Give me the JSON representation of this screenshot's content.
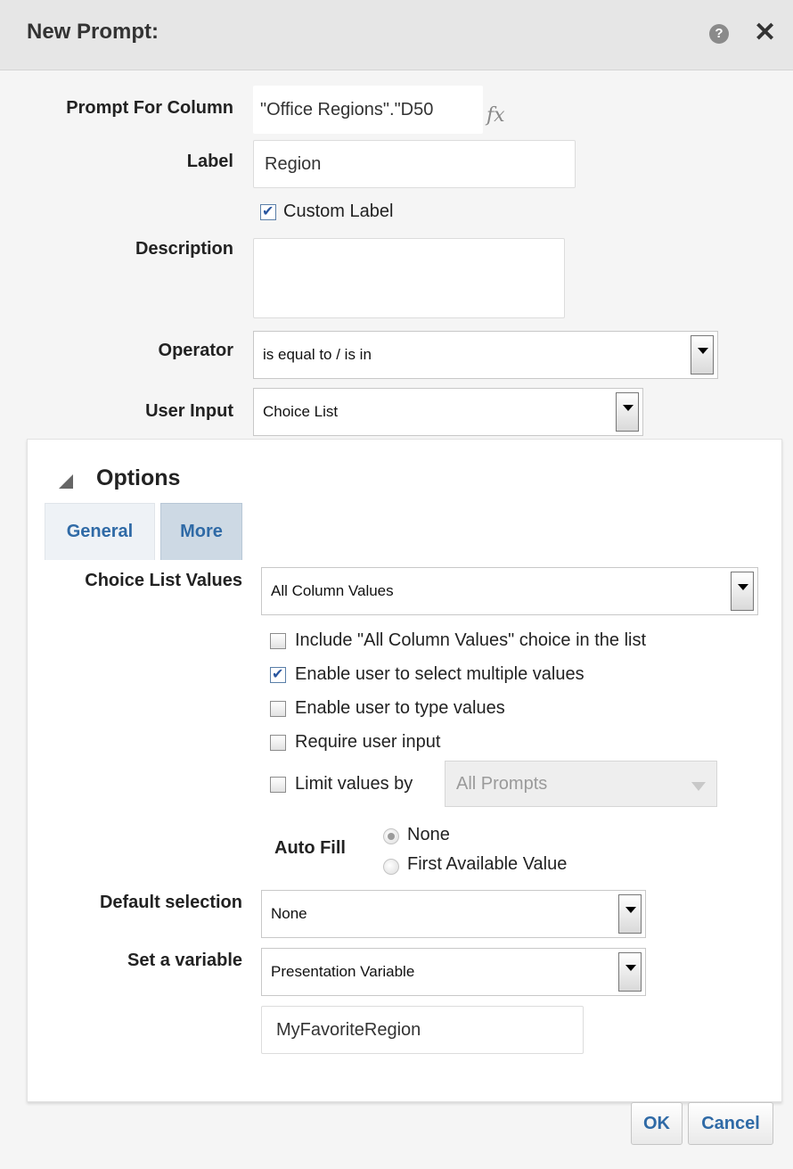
{
  "dialog": {
    "title": "New Prompt:",
    "help_icon": "question-circle-icon",
    "close_icon": "close-icon",
    "help_glyph": "?",
    "close_glyph": "✕"
  },
  "form": {
    "prompt_for_column": {
      "label": "Prompt For Column",
      "value": "\"Office Regions\".\"D50",
      "fx_glyph": "fx"
    },
    "label": {
      "label": "Label",
      "value": "Region"
    },
    "custom_label": {
      "text": "Custom Label",
      "checked": true
    },
    "description": {
      "label": "Description",
      "value": ""
    },
    "operator": {
      "label": "Operator",
      "value": "is equal to / is in"
    },
    "user_input": {
      "label": "User Input",
      "value": "Choice List"
    }
  },
  "options": {
    "title": "Options",
    "tabs": [
      {
        "label": "General",
        "active": false
      },
      {
        "label": "More",
        "active": true
      }
    ],
    "choice_list_values": {
      "label": "Choice List Values",
      "value": "All Column Values"
    },
    "checkboxes": [
      {
        "text": "Include \"All Column Values\" choice in the list",
        "checked": false
      },
      {
        "text": "Enable user to select multiple values",
        "checked": true
      },
      {
        "text": "Enable user to type values",
        "checked": false
      },
      {
        "text": "Require user input",
        "checked": false
      },
      {
        "text": "Limit values by",
        "checked": false
      }
    ],
    "limit_values_by": {
      "value": "All Prompts",
      "disabled": true
    },
    "auto_fill": {
      "label": "Auto Fill",
      "options": [
        {
          "text": "None",
          "selected": true
        },
        {
          "text": "First Available Value",
          "selected": false
        }
      ]
    },
    "default_selection": {
      "label": "Default selection",
      "value": "None"
    },
    "set_variable": {
      "label": "Set a variable",
      "value": "Presentation Variable"
    },
    "variable_name": {
      "value": "MyFavoriteRegion"
    }
  },
  "buttons": {
    "ok": "OK",
    "cancel": "Cancel"
  },
  "colors": {
    "accent": "#2f6aa6",
    "titlebar": "#e6e6e6",
    "panel": "#ffffff"
  }
}
